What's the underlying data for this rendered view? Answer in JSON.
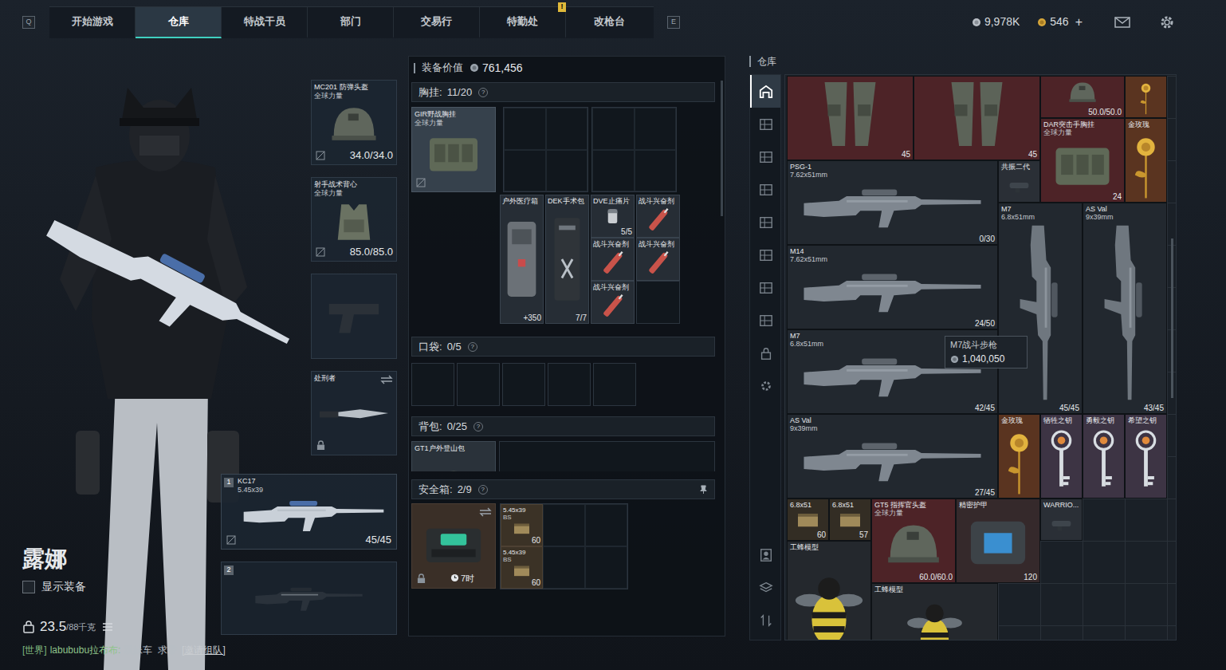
{
  "nav": {
    "left_key": "Q",
    "right_key": "E",
    "alert": "!",
    "tabs": [
      {
        "label": "开始游戏",
        "selected": false
      },
      {
        "label": "仓库",
        "selected": true
      },
      {
        "label": "特战干员",
        "selected": false
      },
      {
        "label": "部门",
        "selected": false
      },
      {
        "label": "交易行",
        "selected": false
      },
      {
        "label": "特勤处",
        "selected": false
      },
      {
        "label": "改枪台",
        "selected": false
      }
    ]
  },
  "currency": {
    "silver": "9,978K",
    "gold": "546",
    "add": "+"
  },
  "operator": {
    "name": "露娜",
    "show_gear": {
      "label": "显示装备",
      "checked": false
    },
    "weight": "23.5",
    "capacity": "/88千克"
  },
  "chat": {
    "channel": "[世界]",
    "sender": "labububu拉布布:",
    "message": "双妹车  求带",
    "invite": "[邀请组队]"
  },
  "loadout": {
    "helmet": {
      "name": "MC201 防弹头盔",
      "sub": "全球力量",
      "durability": "34.0/34.0"
    },
    "armor": {
      "name": "射手战术背心",
      "sub": "全球力量",
      "durability": "85.0/85.0"
    },
    "melee": {
      "name": "处刑者"
    },
    "primary": {
      "slot": "1",
      "name": "KC17",
      "caliber": "5.45x39",
      "ammo": "45/45"
    },
    "secondary": {
      "slot": "2"
    }
  },
  "gear": {
    "value_label": "装备价值",
    "value": "761,456",
    "chest": {
      "label": "胸挂:",
      "count": "11/20",
      "help": "?",
      "rig": {
        "name": "GIR野战胸挂",
        "sub": "全球力量"
      },
      "items": [
        {
          "name": "户外医疗箱",
          "value": "+350",
          "kind": "medkit"
        },
        {
          "name": "DEK手术包",
          "value": "7/7",
          "kind": "surgery"
        },
        {
          "name": "DVE止痛片",
          "value": "5/5",
          "kind": "pill"
        },
        {
          "name": "战斗兴奋剂",
          "kind": "stim"
        },
        {
          "name": "战斗兴奋剂",
          "kind": "stim"
        },
        {
          "name": "战斗兴奋剂",
          "kind": "stim"
        },
        {
          "name": "战斗兴奋剂",
          "kind": "stim"
        }
      ]
    },
    "pockets": {
      "label": "口袋:",
      "count": "0/5",
      "help": "?"
    },
    "backpack": {
      "label": "背包:",
      "count": "0/25",
      "help": "?",
      "bag": {
        "name": "GT1户外登山包"
      }
    },
    "safe": {
      "label": "安全箱:",
      "count": "2/9",
      "help": "?",
      "timer": "7时",
      "items": [
        {
          "name": "5.45x39",
          "sub": "BS",
          "count": "60"
        },
        {
          "name": "5.45x39",
          "sub": "BS",
          "count": "60"
        }
      ]
    }
  },
  "warehouse": {
    "title": "仓库",
    "sidebar": [
      {
        "kind": "house",
        "selected": true
      },
      {
        "kind": "shelf",
        "selected": false
      },
      {
        "kind": "shelf",
        "selected": false
      },
      {
        "kind": "shelf",
        "selected": false
      },
      {
        "kind": "shelf",
        "selected": false
      },
      {
        "kind": "shelf",
        "selected": false
      },
      {
        "kind": "shelf",
        "selected": false
      },
      {
        "kind": "shelf",
        "selected": false
      },
      {
        "kind": "lock",
        "selected": false
      },
      {
        "kind": "gear",
        "selected": false
      },
      {
        "kind": "person",
        "selected": false
      },
      {
        "kind": "layers",
        "selected": false
      },
      {
        "kind": "sort",
        "selected": false
      }
    ],
    "items": [
      {
        "value": "45",
        "kind": "pants",
        "color": "#4d2327"
      },
      {
        "value": "45",
        "kind": "pants",
        "color": "#4d2327"
      },
      {
        "value": "50.0/50.0",
        "kind": "helmet",
        "color": "#4d2327"
      },
      {
        "kind": "rose",
        "color": "#5a3420"
      },
      {
        "name": "DAR突击手胸挂",
        "sub": "全球力量",
        "value": "24",
        "kind": "rig",
        "color": "#4d2327"
      },
      {
        "name": "金玫瑰",
        "kind": "rose",
        "color": "#5a3420"
      },
      {
        "name": "PSG-1",
        "sub": "7.62x51mm",
        "value": "0/30",
        "kind": "rifle",
        "color": "#22282f"
      },
      {
        "name": "共振二代",
        "kind": "scope",
        "color": "#2a2f36"
      },
      {
        "name": "M7",
        "sub": "6.8x51mm",
        "value": "45/45",
        "kind": "rifle-v",
        "color": "#22282f"
      },
      {
        "name": "AS Val",
        "sub": "9x39mm",
        "value": "43/45",
        "kind": "rifle-v",
        "color": "#22282f"
      },
      {
        "name": "M14",
        "sub": "7.62x51mm",
        "value": "24/50",
        "kind": "rifle",
        "color": "#22282f"
      },
      {
        "name": "M7",
        "sub": "6.8x51mm",
        "value": "42/45",
        "kind": "rifle",
        "color": "#22282f"
      },
      {
        "name": "AS Val",
        "sub": "9x39mm",
        "value": "27/45",
        "kind": "rifle",
        "color": "#22282f"
      },
      {
        "name": "金玫瑰",
        "kind": "rose",
        "color": "#5a3420"
      },
      {
        "name": "牺牲之钥",
        "kind": "key",
        "color": "#3d3444"
      },
      {
        "name": "勇毅之钥",
        "kind": "key",
        "color": "#3d3444"
      },
      {
        "name": "希望之钥",
        "kind": "key",
        "color": "#3d3444"
      },
      {
        "name": "6.8x51",
        "value": "60",
        "kind": "ammo",
        "color": "#332d24"
      },
      {
        "name": "6.8x51",
        "value": "57",
        "kind": "ammo",
        "color": "#332d24"
      },
      {
        "name": "GT5 指挥官头盔",
        "sub": "全球力量",
        "value": "60.0/60.0",
        "kind": "helmet",
        "color": "#4d2327"
      },
      {
        "name": "精密护甲",
        "value": "120",
        "kind": "armor-case",
        "color": "#35292b"
      },
      {
        "name": "WARRIO...",
        "kind": "scope",
        "color": "#2a2f36"
      },
      {
        "name": "工蜂模型",
        "kind": "bee",
        "color": "#24282d"
      },
      {
        "name": "工蜂模型",
        "kind": "bee",
        "color": "#24282d"
      }
    ],
    "tooltip": {
      "name": "M7战斗步枪",
      "price": "1,040,050"
    }
  }
}
